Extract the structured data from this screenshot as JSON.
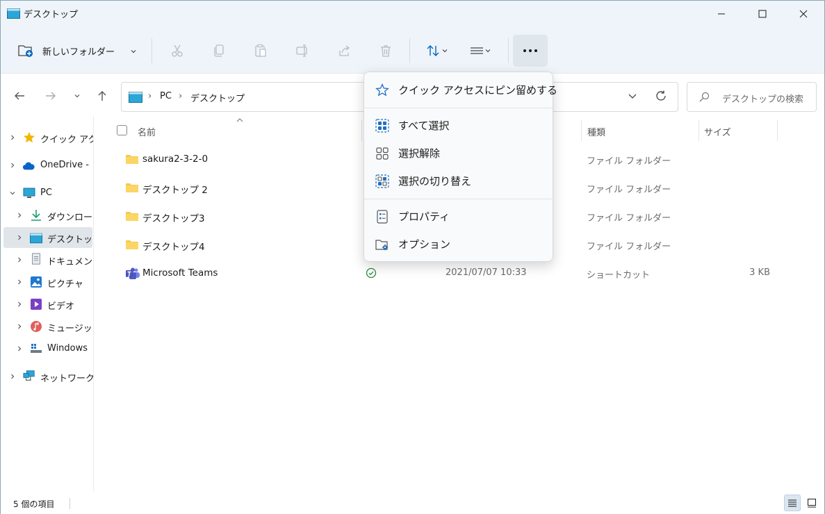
{
  "window": {
    "title": "デスクトップ"
  },
  "toolbar": {
    "new_folder_label": "新しいフォルダー"
  },
  "address": {
    "crumbs": [
      "PC",
      "デスクトップ"
    ],
    "search_placeholder": "デスクトップの検索"
  },
  "sidebar": {
    "items": [
      {
        "label": "クイック アクセス",
        "icon": "star-icon"
      },
      {
        "label": "OneDrive - ",
        "icon": "cloud-icon"
      },
      {
        "label": "PC",
        "icon": "pc-icon"
      },
      {
        "label": "ダウンロード",
        "icon": "download-icon"
      },
      {
        "label": "デスクトップ",
        "icon": "desktop-icon"
      },
      {
        "label": "ドキュメント",
        "icon": "document-icon"
      },
      {
        "label": "ピクチャ",
        "icon": "pictures-icon"
      },
      {
        "label": "ビデオ",
        "icon": "video-icon"
      },
      {
        "label": "ミュージック",
        "icon": "music-icon"
      },
      {
        "label": "Windows",
        "icon": "drive-icon"
      },
      {
        "label": "ネットワーク",
        "icon": "network-icon"
      }
    ]
  },
  "columns": {
    "name": "名前",
    "type": "種類",
    "size": "サイズ"
  },
  "files": [
    {
      "name": "sakura2-3-2-0",
      "date": "",
      "type": "ファイル フォルダー",
      "size": ""
    },
    {
      "name": "デスクトップ 2",
      "date": "",
      "type": "ファイル フォルダー",
      "size": ""
    },
    {
      "name": "デスクトップ3",
      "date": "",
      "type": "ファイル フォルダー",
      "size": ""
    },
    {
      "name": "デスクトップ4",
      "date": "",
      "type": "ファイル フォルダー",
      "size": ""
    },
    {
      "name": "Microsoft Teams",
      "date": "2021/07/07 10:33",
      "type": "ショートカット",
      "size": "3 KB"
    }
  ],
  "menu": {
    "items": [
      {
        "label": "クイック アクセスにピン留めする",
        "icon": "pin-star-icon"
      },
      {
        "label": "すべて選択",
        "icon": "select-all-icon"
      },
      {
        "label": "選択解除",
        "icon": "select-none-icon"
      },
      {
        "label": "選択の切り替え",
        "icon": "invert-selection-icon"
      },
      {
        "label": "プロパティ",
        "icon": "properties-icon"
      },
      {
        "label": "オプション",
        "icon": "options-icon"
      }
    ]
  },
  "status": {
    "item_count": "5 個の項目"
  },
  "colors": {
    "accent": "#0067c0",
    "chrome": "#eef4f9",
    "folder": "#f6c94f"
  }
}
